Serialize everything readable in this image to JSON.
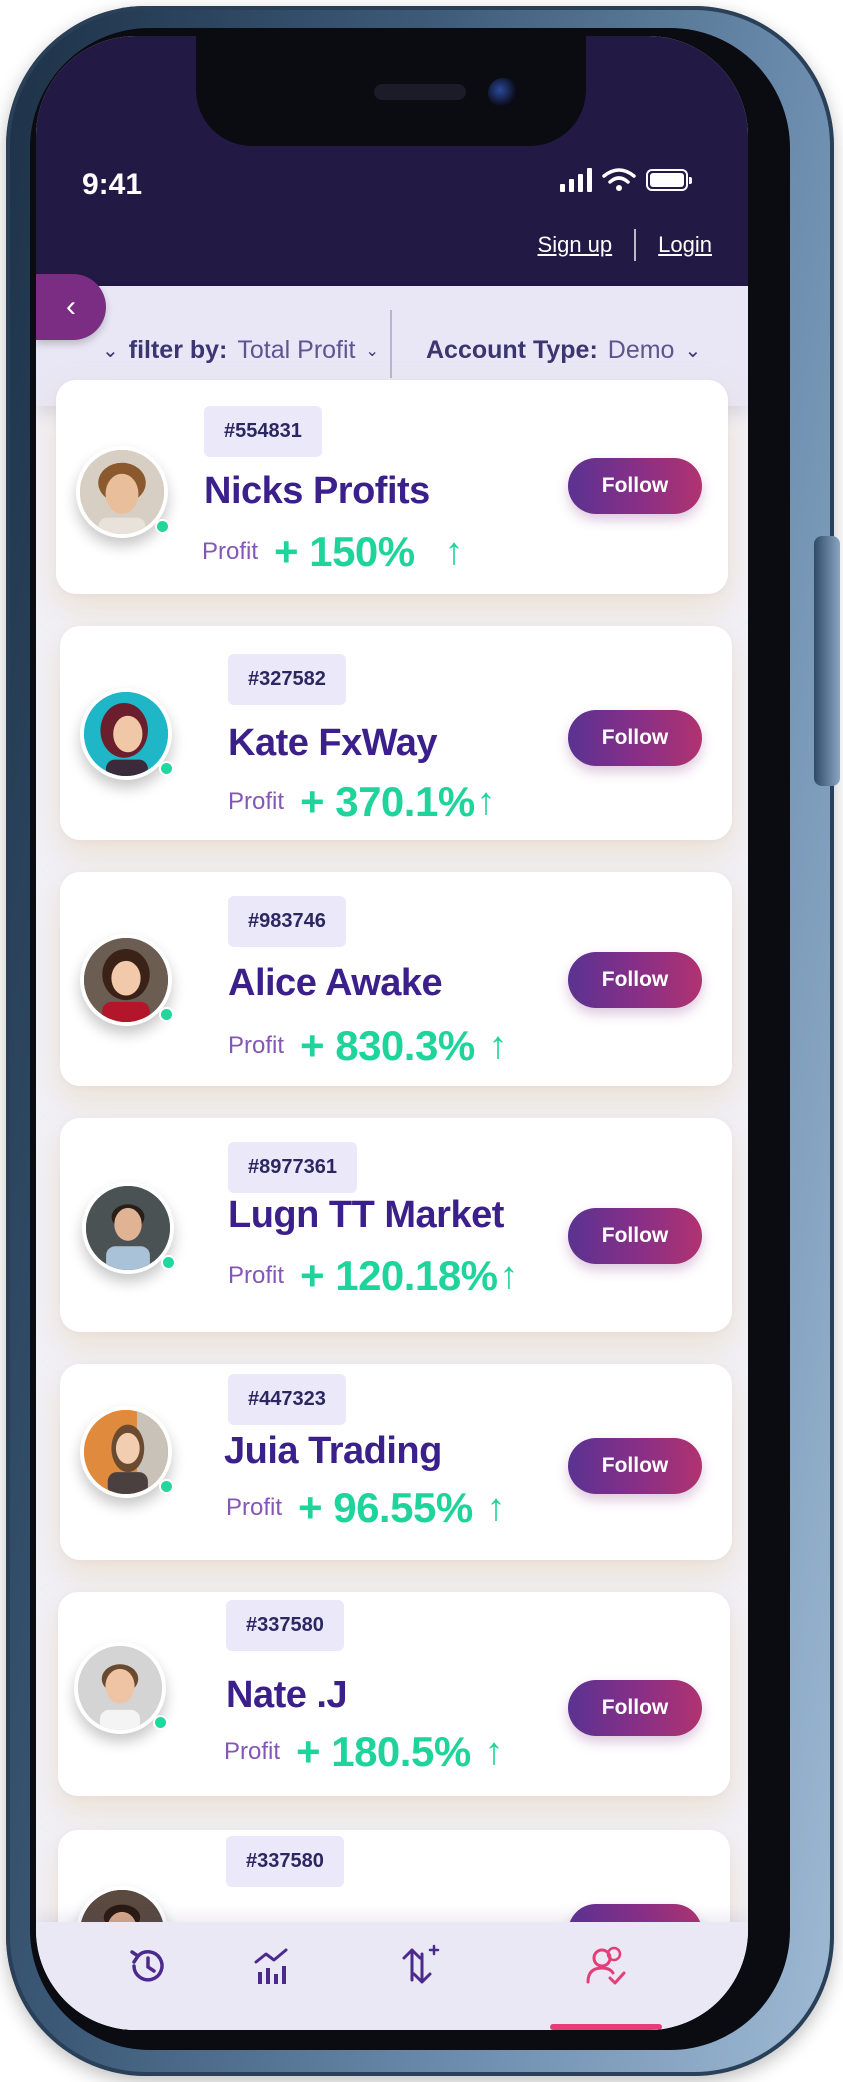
{
  "status_bar": {
    "time": "9:41"
  },
  "auth": {
    "sign_up": "Sign up",
    "login": "Login"
  },
  "filters": {
    "filter_by_label": "filter by:",
    "filter_by_value": "Total Profit",
    "account_type_label": "Account Type:",
    "account_type_value": "Demo"
  },
  "profit_label": "Profit",
  "follow_label": "Follow",
  "traders": [
    {
      "id": "#554831",
      "name": "Nicks  Profits",
      "profit": "+ 150%",
      "arrow": "↑"
    },
    {
      "id": "#327582",
      "name": "Kate FxWay",
      "profit": "+ 370.1%",
      "arrow": "↑"
    },
    {
      "id": "#983746",
      "name": "Alice Awake",
      "profit": "+ 830.3%",
      "arrow": "↑"
    },
    {
      "id": "#8977361",
      "name": "Lugn TT Market",
      "profit": "+ 120.18%",
      "arrow": "↑"
    },
    {
      "id": "#447323",
      "name": "Juia Trading",
      "profit": "+ 96.55%",
      "arrow": "↑"
    },
    {
      "id": "#337580",
      "name": "Nate .J",
      "profit": "+ 180.5%",
      "arrow": "↑"
    },
    {
      "id": "#337580",
      "name": "",
      "profit": "",
      "arrow": ""
    }
  ],
  "bottom_nav": {
    "items": [
      "history-icon",
      "chart-icon",
      "trade-icon",
      "copy-traders-icon"
    ],
    "active": "copy-traders-icon"
  },
  "colors": {
    "header": "#221a45",
    "accent_purple": "#3b1f8a",
    "profit_green": "#1fd49a",
    "follow_gradient_start": "#5b3291",
    "follow_gradient_end": "#b0336f",
    "active_tab": "#e63c78"
  }
}
